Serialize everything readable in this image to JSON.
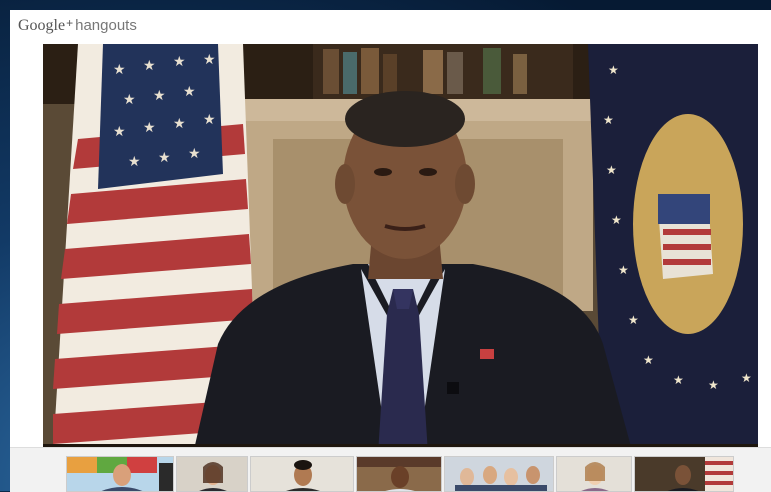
{
  "app": {
    "brand_google": "Google",
    "brand_plus": "+",
    "brand_product": "hangouts"
  },
  "stage": {
    "speaker": "main-video"
  },
  "filmstrip": {
    "participants": [
      {
        "id": "p1"
      },
      {
        "id": "p2"
      },
      {
        "id": "p3"
      },
      {
        "id": "p4"
      },
      {
        "id": "p5"
      },
      {
        "id": "p6"
      },
      {
        "id": "p7"
      }
    ]
  }
}
